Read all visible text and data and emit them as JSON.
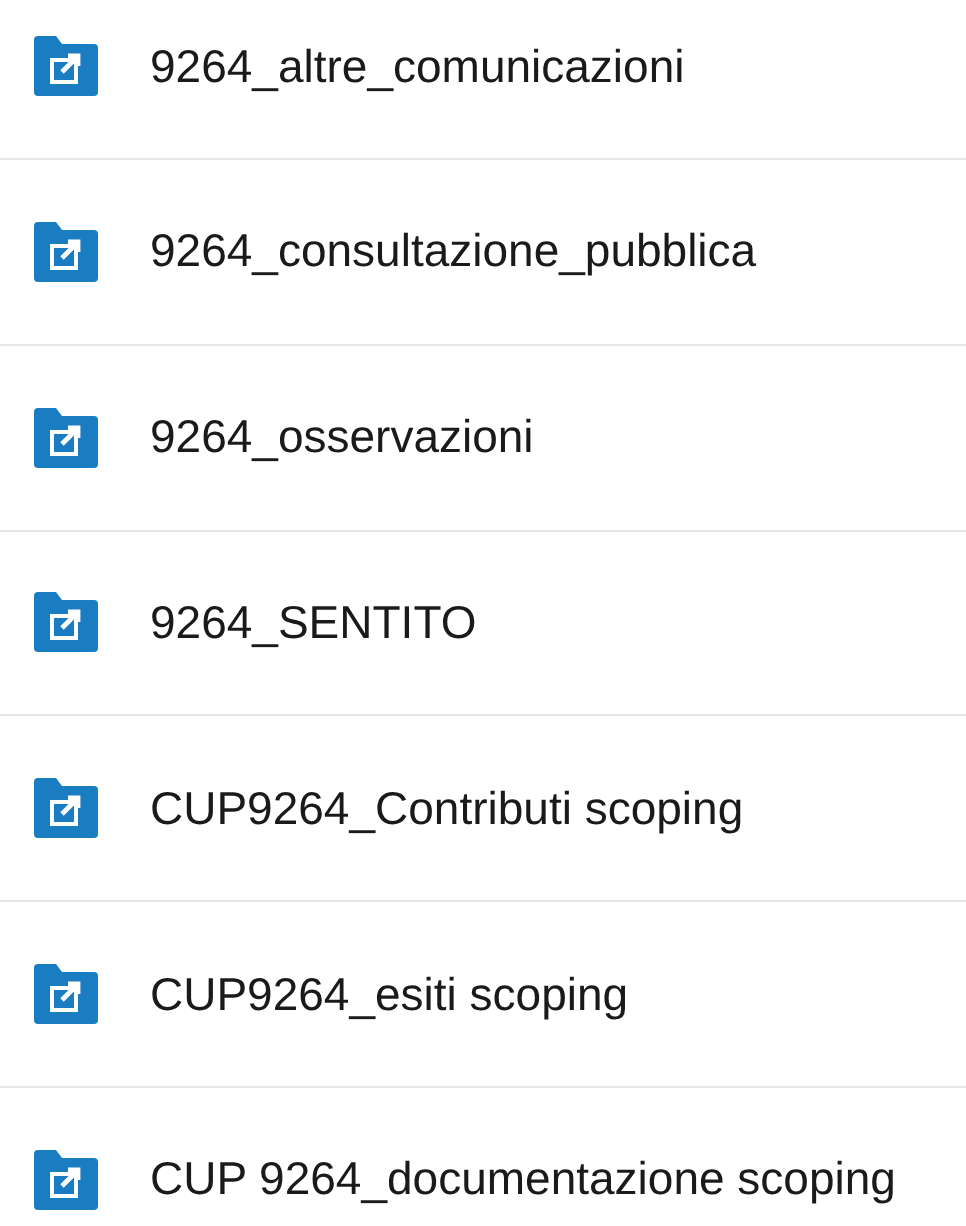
{
  "items": [
    {
      "name": "9264_altre_comunicazioni"
    },
    {
      "name": "9264_consultazione_pubblica"
    },
    {
      "name": "9264_osservazioni"
    },
    {
      "name": "9264_SENTITO"
    },
    {
      "name": "CUP9264_Contributi scoping"
    },
    {
      "name": "CUP9264_esiti scoping"
    },
    {
      "name": "CUP 9264_documentazione scoping"
    }
  ]
}
